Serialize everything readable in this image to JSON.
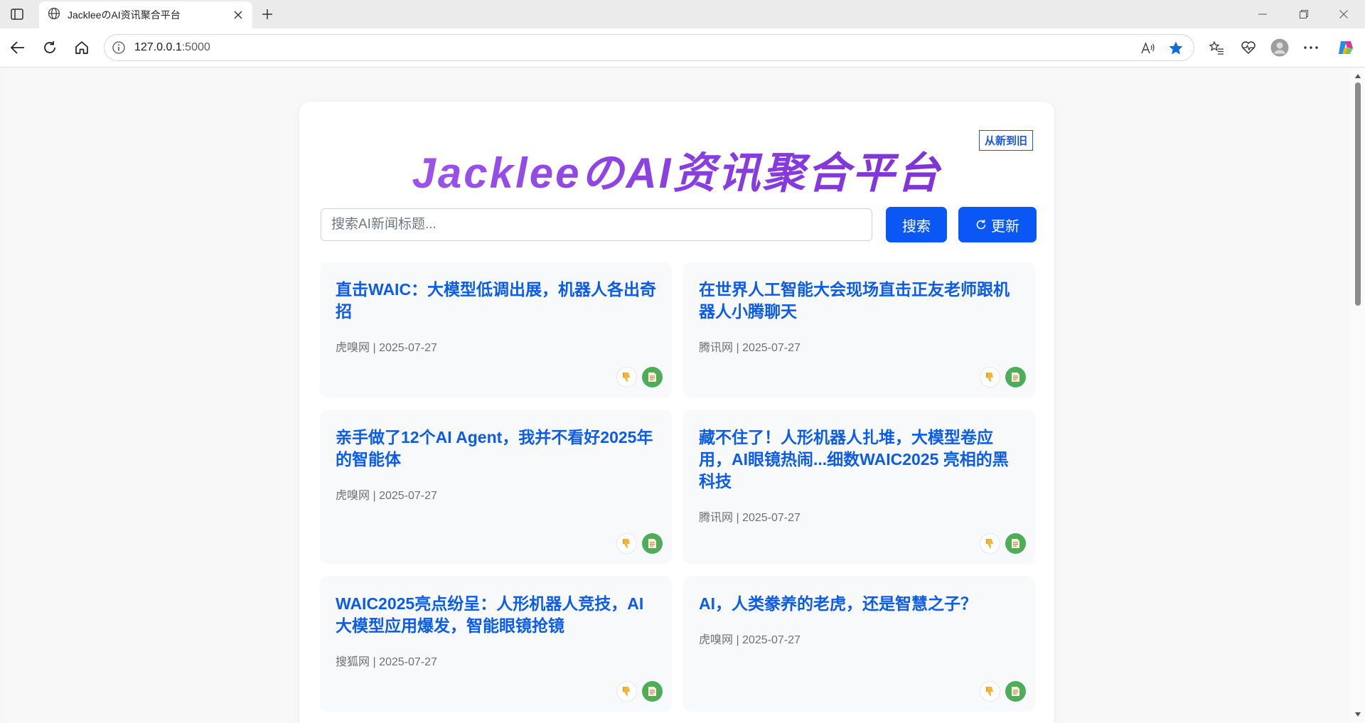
{
  "browser": {
    "tab_title": "JackleeのAI资讯聚合平台",
    "url_host": "127.0.0.1",
    "url_port": ":5000"
  },
  "page": {
    "title": "JackleeのAI资讯聚合平台",
    "sort_label": "从新到旧",
    "search": {
      "placeholder": "搜索AI新闻标题...",
      "value": "",
      "button_label": "搜索"
    },
    "refresh_label": "更新",
    "articles": [
      {
        "title": "直击WAIC：大模型低调出展，机器人各出奇招",
        "source": "虎嗅网",
        "date": "2025-07-27"
      },
      {
        "title": "在世界人工智能大会现场直击正友老师跟机器人小腾聊天",
        "source": "腾讯网",
        "date": "2025-07-27"
      },
      {
        "title": "亲手做了12个AI Agent，我并不看好2025年的智能体",
        "source": "虎嗅网",
        "date": "2025-07-27"
      },
      {
        "title": "藏不住了！人形机器人扎堆，大模型卷应用，AI眼镜热闹...细数WAIC2025 亮相的黑科技",
        "source": "腾讯网",
        "date": "2025-07-27"
      },
      {
        "title": "WAIC2025亮点纷呈：人形机器人竞技，AI大模型应用爆发，智能眼镜抢镜",
        "source": "搜狐网",
        "date": "2025-07-27"
      },
      {
        "title": "AI，人类豢养的老虎，还是智慧之子？",
        "source": "虎嗅网",
        "date": "2025-07-27"
      }
    ],
    "meta_separator": " | "
  },
  "colors": {
    "accent_blue": "#0a57f5",
    "title_gradient_start": "#a45cf0",
    "title_gradient_end": "#7a2fd0",
    "summary_green": "#4cae5b"
  },
  "icons": {
    "dislike": "thumbs-down-icon",
    "summary": "document-icon"
  }
}
